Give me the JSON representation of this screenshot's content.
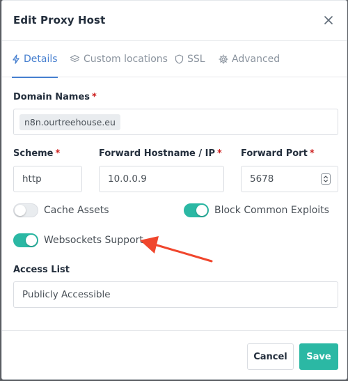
{
  "modal": {
    "title": "Edit Proxy Host"
  },
  "tabs": [
    {
      "label": "Details",
      "icon": "bolt-icon",
      "active": true
    },
    {
      "label": "Custom locations",
      "icon": "layers-icon",
      "active": false
    },
    {
      "label": "SSL",
      "icon": "shield-icon",
      "active": false
    },
    {
      "label": "Advanced",
      "icon": "gear-icon",
      "active": false
    }
  ],
  "form": {
    "domain_names": {
      "label": "Domain Names",
      "required": "*",
      "chips": [
        "n8n.ourtreehouse.eu"
      ]
    },
    "scheme": {
      "label": "Scheme",
      "required": "*",
      "value": "http"
    },
    "forward_host": {
      "label": "Forward Hostname / IP",
      "required": "*",
      "value": "10.0.0.9"
    },
    "forward_port": {
      "label": "Forward Port",
      "required": "*",
      "value": "5678"
    },
    "toggles": {
      "cache_assets": {
        "label": "Cache Assets",
        "on": false
      },
      "block_exploits": {
        "label": "Block Common Exploits",
        "on": true
      },
      "websockets": {
        "label": "Websockets Support",
        "on": true
      }
    },
    "access_list": {
      "label": "Access List",
      "value": "Publicly Accessible"
    }
  },
  "footer": {
    "cancel_label": "Cancel",
    "save_label": "Save"
  },
  "colors": {
    "accent": "#467fcf",
    "toggle_on": "#2bb8a4",
    "required": "#cd201f",
    "annotation": "#f0462d"
  }
}
